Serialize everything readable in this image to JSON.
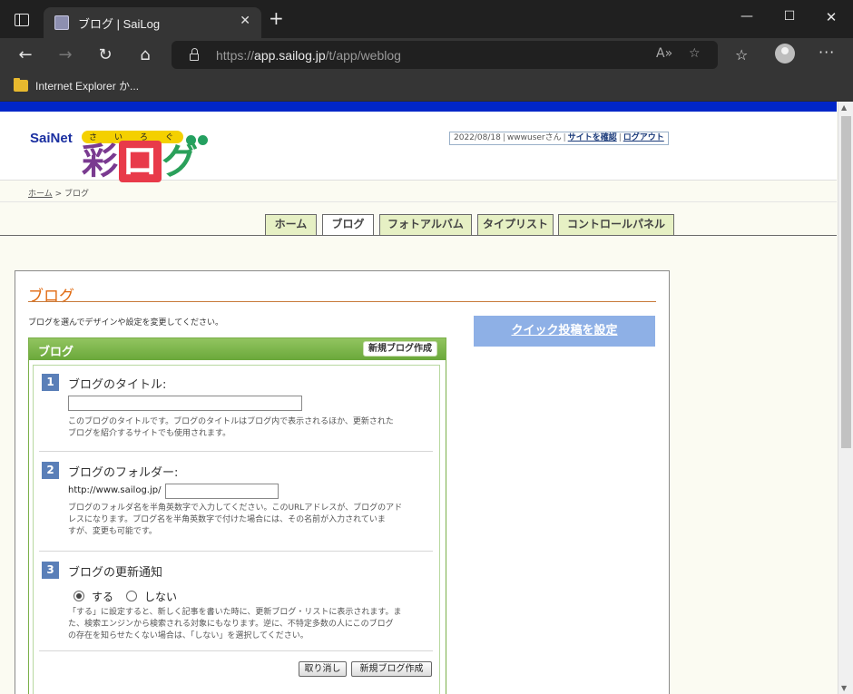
{
  "browser": {
    "tab_title": "ブログ | SaiLog",
    "url_prefix": "https://",
    "url_host": "app.sailog.jp",
    "url_path": "/t/app/weblog",
    "favorites_item": "Internet Explorer か...",
    "icons": {
      "window": "window-icon",
      "favicon": "favicon-icon",
      "close_tab": "close-icon",
      "new_tab": "plus-icon",
      "back": "back-arrow-icon",
      "forward": "forward-arrow-icon",
      "reload": "reload-icon",
      "home": "home-icon",
      "lock": "lock-icon",
      "read_aloud": "read-aloud-icon",
      "add_favorite": "add-favorite-icon",
      "favorites": "favorites-icon",
      "profile": "profile-icon",
      "more": "more-icon",
      "folder": "folder-icon"
    }
  },
  "header": {
    "logo_sainet": "SaiNet",
    "logo_ruby": [
      "さ",
      "い",
      "ろ",
      "ぐ"
    ],
    "logo_main": [
      "彩",
      "ロ",
      "グ"
    ],
    "user_date": "2022/08/18",
    "user_name": "wwwuserさん",
    "site_link": "サイトを確認",
    "logout_link": "ログアウト"
  },
  "breadcrumb": {
    "home": "ホーム",
    "separator": ">",
    "current": "ブログ"
  },
  "tabs": [
    {
      "label": "ホーム",
      "active": false
    },
    {
      "label": "ブログ",
      "active": true
    },
    {
      "label": "フォトアルバム",
      "active": false
    },
    {
      "label": "タイプリスト",
      "active": false
    },
    {
      "label": "コントロールパネル",
      "active": false
    }
  ],
  "content": {
    "section_title": "ブログ",
    "intro": "ブログを選んでデザインや設定を変更してください。",
    "quick_post_button": "クイック投稿を設定",
    "panel": {
      "title": "ブログ",
      "new_button": "新規ブログ作成",
      "steps": [
        {
          "num": "1",
          "label": "ブログのタイトル:",
          "input_value": "",
          "desc_line1": "このブログのタイトルです。ブログのタイトルはブログ内で表示されるほか、更新された",
          "desc_line2": "ブログを紹介するサイトでも使用されます。"
        },
        {
          "num": "2",
          "label": "ブログのフォルダー:",
          "url_prefix": "http://www.sailog.jp/",
          "input_value": "",
          "desc_line1": "ブログのフォルダ名を半角英数字で入力してください。このURLアドレスが、ブログのアド",
          "desc_line2": "レスになります。ブログ名を半角英数字で付けた場合には、その名前が入力されていま",
          "desc_line3": "すが、変更も可能です。"
        },
        {
          "num": "3",
          "label": "ブログの更新通知",
          "option_yes": "する",
          "option_no": "しない",
          "selected": "する",
          "desc_line1": "「する」に設定すると、新しく記事を書いた時に、更新ブログ・リストに表示されます。ま",
          "desc_line2": "た、検索エンジンから検索される対象にもなります。逆に、不特定多数の人にこのブログ",
          "desc_line3": "の存在を知らせたくない場合は、「しない」を選択してください。"
        }
      ],
      "cancel_button": "取り消し",
      "create_button": "新規ブログ作成"
    }
  }
}
